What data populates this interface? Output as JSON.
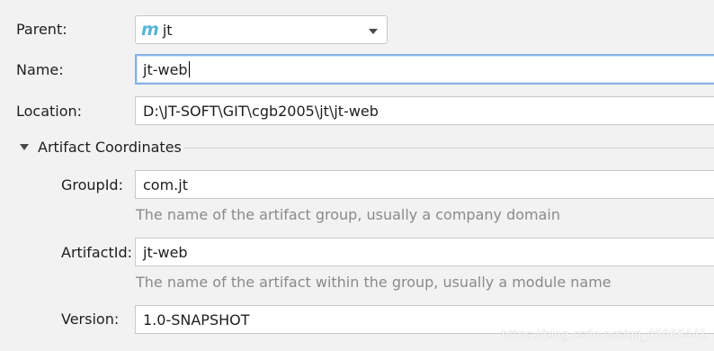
{
  "parent": {
    "label": "Parent:",
    "value": "jt",
    "icon_glyph": "m"
  },
  "name": {
    "label": "Name:",
    "value": "jt-web"
  },
  "location": {
    "label": "Location:",
    "value": "D:\\JT-SOFT\\GIT\\cgb2005\\jt\\jt-web"
  },
  "artifact_coordinates": {
    "title": "Artifact Coordinates",
    "expanded": true,
    "group_id": {
      "label": "GroupId:",
      "value": "com.jt",
      "hint": "The name of the artifact group, usually a company domain"
    },
    "artifact_id": {
      "label": "ArtifactId:",
      "value": "jt-web",
      "hint": "The name of the artifact within the group, usually a module name"
    },
    "version": {
      "label": "Version:",
      "value": "1.0-SNAPSHOT"
    }
  },
  "watermark": "https://blog.csdn.net/qq_45966441",
  "colors": {
    "background": "#f2f2f2",
    "field_background": "#ffffff",
    "focus_border": "#8ab1e3",
    "hint_text": "#8a8a8a",
    "maven_icon": "#55b5d8"
  }
}
